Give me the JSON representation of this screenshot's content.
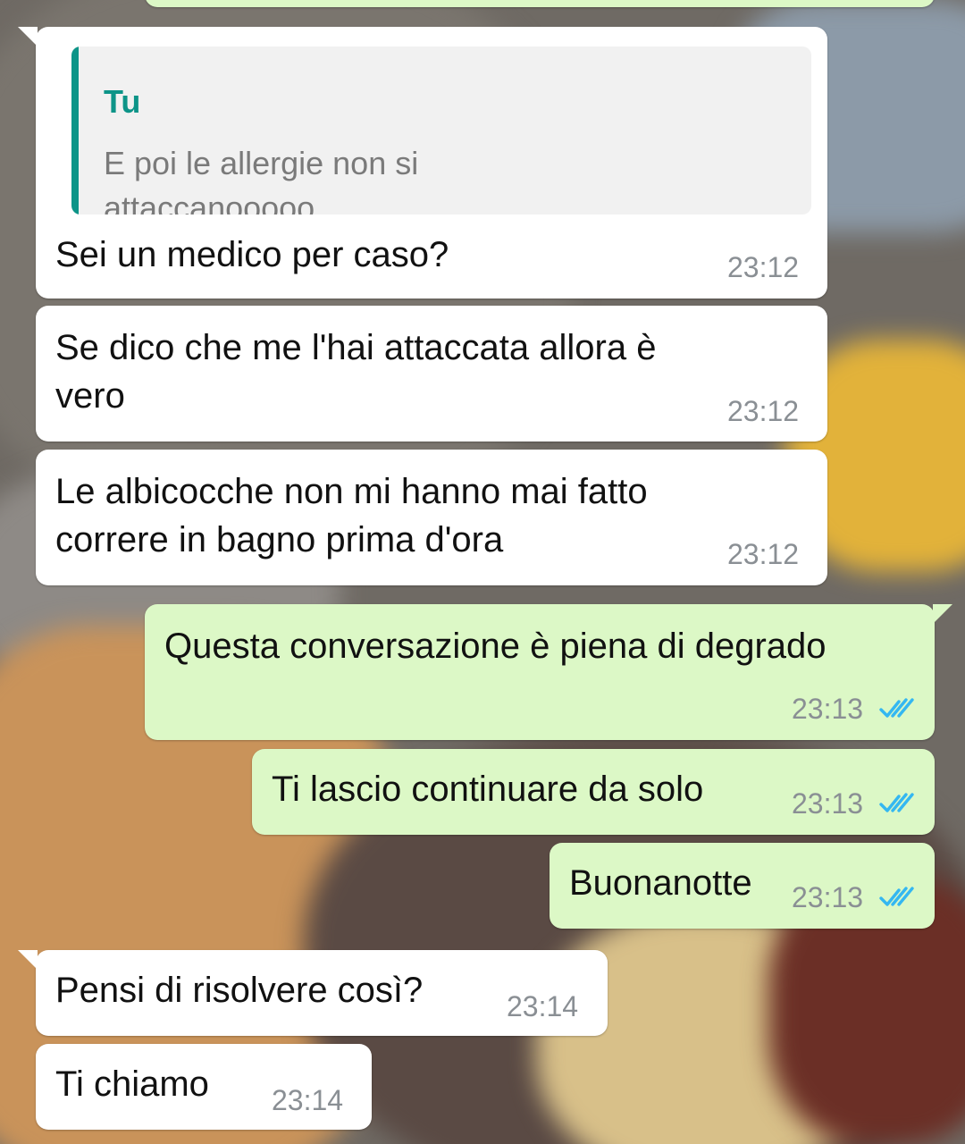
{
  "messages": [
    {
      "id": "m0",
      "direction": "out",
      "text": "",
      "time": ""
    },
    {
      "id": "m1",
      "direction": "in",
      "reply_to": {
        "author": "Tu",
        "text": "E poi le allergie non si\nattaccanooooo"
      },
      "text": "Sei un medico per caso?",
      "time": "23:12"
    },
    {
      "id": "m2",
      "direction": "in",
      "text": "Se dico che me l'hai attaccata allora è\nvero",
      "time": "23:12"
    },
    {
      "id": "m3",
      "direction": "in",
      "text": "Le albicocche non mi hanno mai fatto\ncorrere in bagno prima d'ora",
      "time": "23:12"
    },
    {
      "id": "m4",
      "direction": "out",
      "text": "Questa conversazione è piena di degrado",
      "time": "23:13",
      "status": "read"
    },
    {
      "id": "m5",
      "direction": "out",
      "text": "Ti lascio continuare da solo",
      "time": "23:13",
      "status": "read"
    },
    {
      "id": "m6",
      "direction": "out",
      "text": "Buonanotte",
      "time": "23:13",
      "status": "read"
    },
    {
      "id": "m7",
      "direction": "in",
      "text": "Pensi di risolvere così?",
      "time": "23:14"
    },
    {
      "id": "m8",
      "direction": "in",
      "text": "Ti chiamo",
      "time": "23:14"
    }
  ],
  "colors": {
    "incoming_bubble": "#ffffff",
    "outgoing_bubble": "#dcf8c6",
    "quote_accent": "#0d9488",
    "read_ticks": "#34b7f1",
    "timestamp": "#8a8f94"
  },
  "icons": {
    "read_status": "double-check-icon"
  }
}
